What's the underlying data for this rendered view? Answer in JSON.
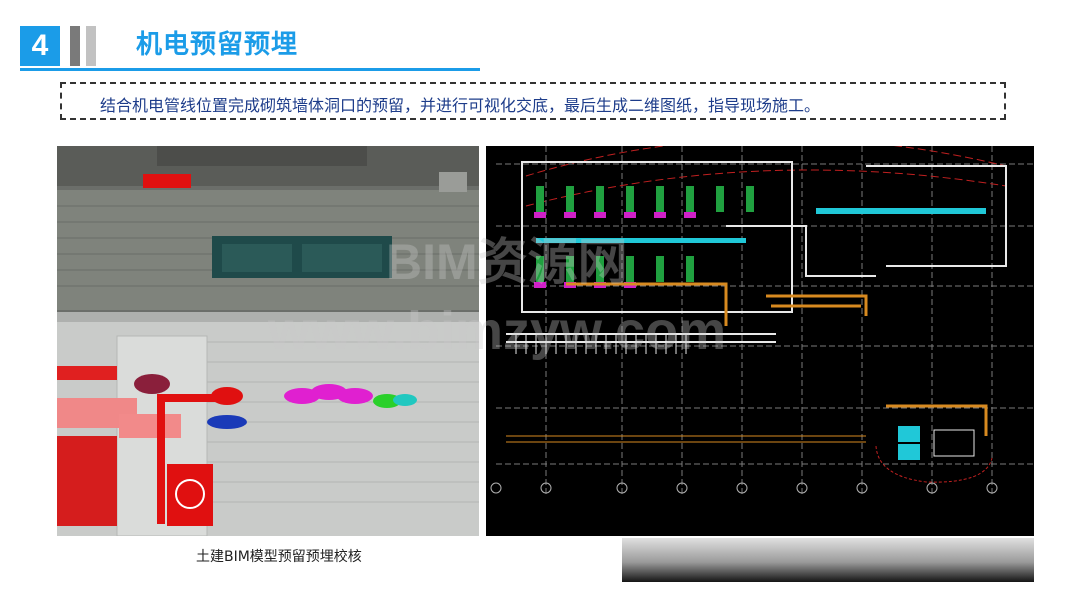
{
  "header": {
    "number": "4",
    "title": "机电预留预埋"
  },
  "note": {
    "text": "结合机电管线位置完成砌筑墙体洞口的预留，并进行可视化交底，最后生成二维图纸，指导现场施工。"
  },
  "images": {
    "left_caption": "土建BIM模型预留预埋校核"
  },
  "watermark": {
    "line1": "BIM资源网",
    "line2": "www.bimzyw.com"
  },
  "colors": {
    "accent": "#1b9ce8",
    "note_text": "#1d3c8a"
  }
}
